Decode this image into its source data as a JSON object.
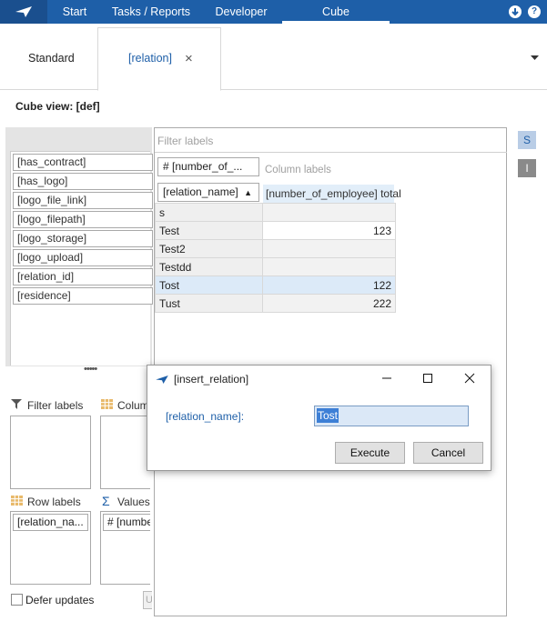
{
  "nav": {
    "items": [
      "Start",
      "Tasks / Reports",
      "Developer",
      "Cube"
    ],
    "active": "Cube",
    "accent": "#1e5fa8",
    "logo_icon": "paper-plane-icon",
    "right_icons": [
      "download-icon",
      "help-icon"
    ],
    "help_glyph": "?"
  },
  "tabs": [
    {
      "label": "Standard"
    },
    {
      "label": "[relation]",
      "active": true,
      "close": "×"
    }
  ],
  "tabs_menu_icon": "dropdown-arrow-icon",
  "cube_view": "Cube view: [def]",
  "fields": [
    "[has_contract]",
    "[has_logo]",
    "[logo_file_link]",
    "[logo_filepath]",
    "[logo_storage]",
    "[logo_upload]",
    "[relation_id]",
    "[residence]"
  ],
  "splitter": "•••••",
  "zones": {
    "filter_label": "Filter labels",
    "column_label": "Columns",
    "row_label": "Row labels",
    "values_label": "Values",
    "row_chip": "[relation_na...",
    "value_chip": "# [numbe"
  },
  "defer_updates": "Defer updates",
  "update_button": "U",
  "pivot": {
    "filter_placeholder": "Filter labels",
    "measure_chip": "# [number_of_...",
    "column_labels_placeholder": "Column labels",
    "row_field_chip": "[relation_name]",
    "sort_glyph": "▲",
    "column_header": "[number_of_employee] total",
    "rows": [
      {
        "name": "s",
        "value": ""
      },
      {
        "name": "Test",
        "value": "123"
      },
      {
        "name": "Test2",
        "value": ""
      },
      {
        "name": "Testdd",
        "value": ""
      },
      {
        "name": "Tost",
        "value": "122"
      },
      {
        "name": "Tust",
        "value": "222"
      }
    ],
    "selected_row": "Tost"
  },
  "side_buttons": [
    "S",
    "I"
  ],
  "dialog": {
    "title": "[insert_relation]",
    "field_label": "[relation_name]:",
    "field_value": "Tost",
    "execute": "Execute",
    "cancel": "Cancel",
    "window_controls": [
      "minimize-icon",
      "maximize-icon",
      "close-icon"
    ]
  }
}
